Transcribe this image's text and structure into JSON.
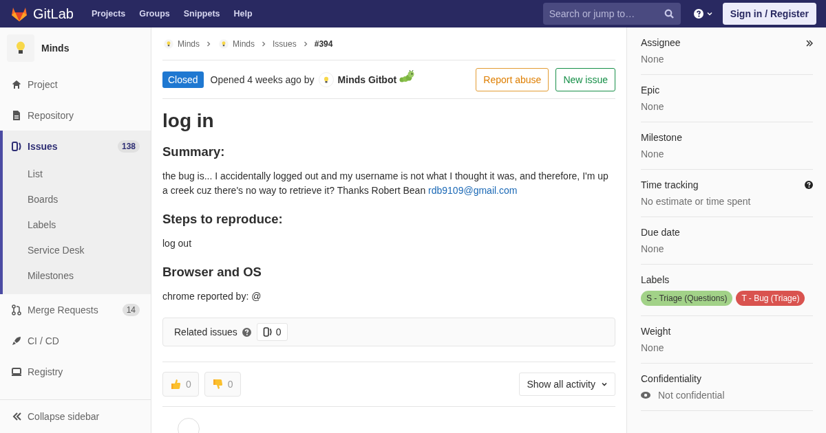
{
  "navbar": {
    "brand": "GitLab",
    "links": [
      "Projects",
      "Groups",
      "Snippets",
      "Help"
    ],
    "search": {
      "placeholder": "Search or jump to…"
    },
    "sign_in": "Sign in / Register"
  },
  "sidebar": {
    "project": "Minds",
    "items": [
      {
        "label": "Project",
        "selected": false
      },
      {
        "label": "Repository",
        "selected": false
      },
      {
        "label": "Issues",
        "count": "138",
        "selected": true,
        "expanded": true,
        "children": [
          {
            "label": "List",
            "selected": false
          },
          {
            "label": "Boards",
            "selected": false
          },
          {
            "label": "Labels",
            "selected": false
          },
          {
            "label": "Service Desk",
            "selected": false
          },
          {
            "label": "Milestones",
            "selected": false
          }
        ]
      },
      {
        "label": "Merge Requests",
        "count": "14",
        "selected": false
      },
      {
        "label": "CI / CD",
        "selected": false
      },
      {
        "label": "Registry",
        "selected": false
      }
    ],
    "collapse": "Collapse sidebar"
  },
  "breadcrumbs": [
    {
      "label": "Minds",
      "avatar": true
    },
    {
      "label": "Minds",
      "avatar": true
    },
    {
      "label": "Issues",
      "avatar": false
    },
    {
      "label": "#394",
      "avatar": false,
      "current": true
    }
  ],
  "issue": {
    "status": "Closed",
    "opened": "Opened 4 weeks ago by",
    "author": "Minds Gitbot",
    "actions": [
      {
        "label": "Report abuse",
        "kind": "warning"
      },
      {
        "label": "New issue",
        "kind": "success"
      }
    ],
    "title": "log in",
    "sections": [
      {
        "heading": "Summary:",
        "text": "the bug is... I accidentally logged out and my username is not what I thought it was, and therefore, I'm up a creek cuz there's no way to retrieve it? Thanks Robert Bean ",
        "link": "rdb9109@gmail.com"
      },
      {
        "heading": "Steps to reproduce:",
        "text": "log out"
      },
      {
        "heading": "Browser and OS",
        "text": "chrome reported by: @"
      }
    ],
    "related": {
      "label": "Related issues",
      "count": "0"
    },
    "reactions": [
      {
        "kind": "thumbsup",
        "count": "0"
      },
      {
        "kind": "thumbsdown",
        "count": "0"
      }
    ],
    "activity_filter": "Show all activity"
  },
  "right_sidebar": [
    {
      "title": "Assignee",
      "value": "None",
      "kind": "text"
    },
    {
      "title": "Epic",
      "value": "None",
      "kind": "text"
    },
    {
      "title": "Milestone",
      "value": "None",
      "kind": "text"
    },
    {
      "title": "Time tracking",
      "value": "No estimate or time spent",
      "kind": "help"
    },
    {
      "title": "Due date",
      "value": "None",
      "kind": "text"
    },
    {
      "title": "Labels",
      "kind": "labels",
      "labels": [
        {
          "text": "S - Triage (Questions)",
          "color": "#a2d288"
        },
        {
          "text": "T - Bug (Triage)",
          "color": "#d9534f"
        }
      ]
    },
    {
      "title": "Weight",
      "value": "None",
      "kind": "text"
    },
    {
      "title": "Confidentiality",
      "value": "Not confidential",
      "kind": "eye"
    }
  ]
}
